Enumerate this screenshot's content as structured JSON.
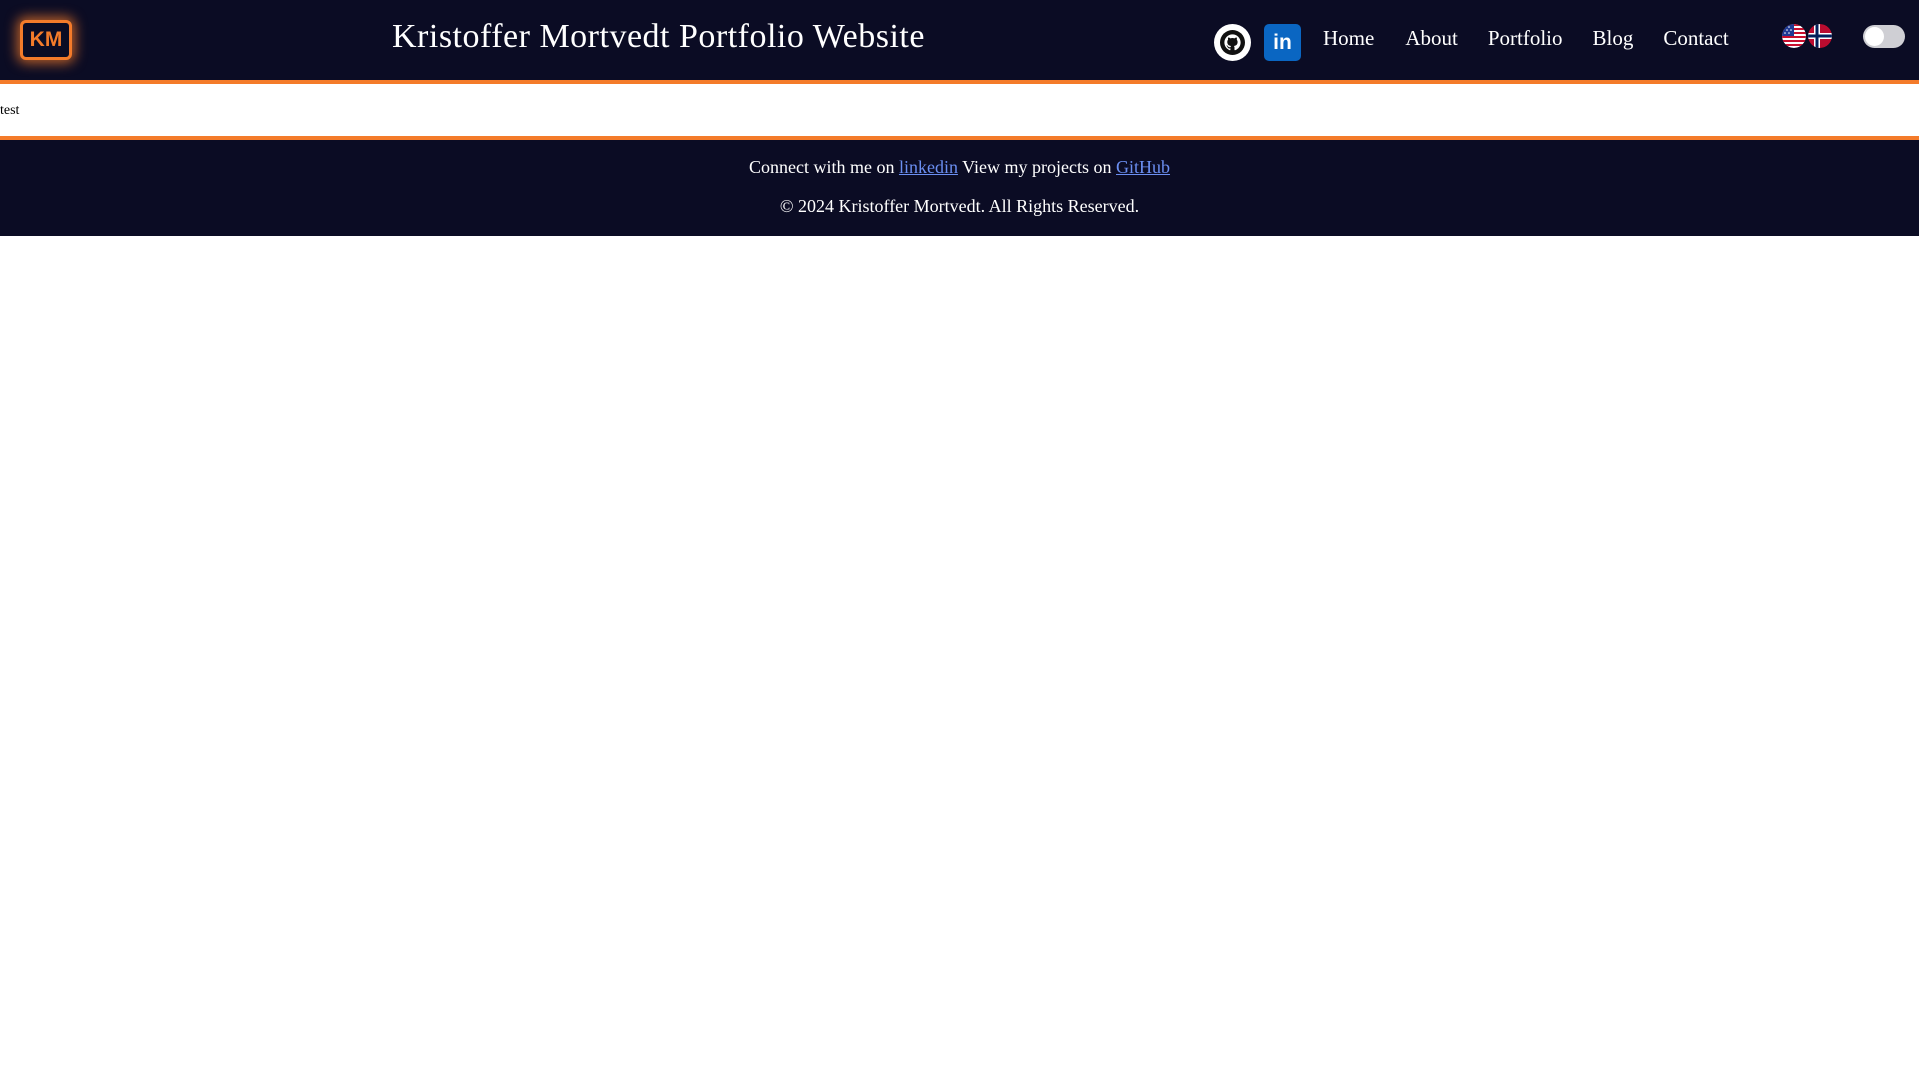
{
  "header": {
    "logo_text": "KM",
    "title": "Kristoffer Mortvedt Portfolio Website",
    "social": {
      "github_icon": "github-icon",
      "linkedin_icon": "linkedin-icon",
      "linkedin_text": "in"
    },
    "nav": [
      {
        "label": "Home"
      },
      {
        "label": "About"
      },
      {
        "label": "Portfolio"
      },
      {
        "label": "Blog"
      },
      {
        "label": "Contact"
      }
    ],
    "language_icons": [
      "us-flag-icon",
      "norway-flag-icon"
    ],
    "theme_toggle": "dark-mode-toggle"
  },
  "main": {
    "text": "test"
  },
  "footer": {
    "connect_prefix": "Connect with me on ",
    "linkedin_link": "linkedin",
    "projects_prefix": " View my projects on ",
    "github_link": "GitHub",
    "copyright": "© 2024 Kristoffer Mortvedt. All Rights Reserved."
  },
  "colors": {
    "navbar_bg": "#0b0c24",
    "accent": "#f47b2a",
    "link": "#6b8ff2",
    "linkedin_blue": "#0a66c2"
  }
}
